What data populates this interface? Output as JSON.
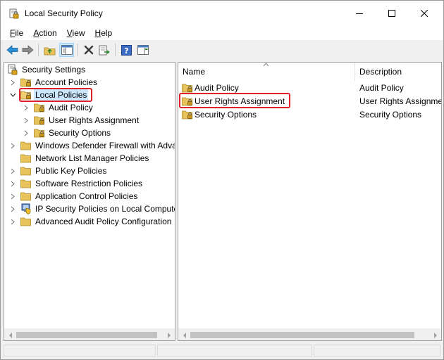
{
  "window": {
    "title": "Local Security Policy",
    "controls": {
      "minimize": "minimize",
      "maximize": "maximize",
      "close": "close"
    }
  },
  "menu": {
    "file": {
      "u": "F",
      "rest": "ile"
    },
    "action": {
      "u": "A",
      "rest": "ction"
    },
    "view": {
      "u": "V",
      "rest": "iew"
    },
    "help": {
      "u": "H",
      "rest": "elp"
    }
  },
  "toolbar": {
    "icons": [
      "back-arrow-icon",
      "forward-arrow-icon",
      "up-folder-icon",
      "show-hide-tree-icon",
      "delete-icon",
      "export-list-icon",
      "help-icon",
      "show-hide-action-pane-icon"
    ]
  },
  "tree": {
    "root": "Security Settings",
    "items": [
      {
        "label": "Account Policies",
        "expanded": false
      },
      {
        "label": "Local Policies",
        "expanded": true,
        "selected": true,
        "children": [
          "Audit Policy",
          "User Rights Assignment",
          "Security Options"
        ]
      },
      {
        "label": "Windows Defender Firewall with Adva",
        "expanded": false
      },
      {
        "label": "Network List Manager Policies",
        "expanded": false
      },
      {
        "label": "Public Key Policies",
        "expanded": false
      },
      {
        "label": "Software Restriction Policies",
        "expanded": false
      },
      {
        "label": "Application Control Policies",
        "expanded": false
      },
      {
        "label": "IP Security Policies on Local Compute",
        "expanded": false
      },
      {
        "label": "Advanced Audit Policy Configuration",
        "expanded": false
      }
    ]
  },
  "list": {
    "columns": [
      "Name",
      "Description"
    ],
    "rows": [
      {
        "name": "Audit Policy",
        "description": "Audit Policy"
      },
      {
        "name": "User Rights Assignment",
        "description": "User Rights Assignme"
      },
      {
        "name": "Security Options",
        "description": "Security Options"
      }
    ]
  },
  "colors": {
    "highlight": "#e0202a",
    "selection": "#cce8ff",
    "folder": "#e8c25a"
  }
}
